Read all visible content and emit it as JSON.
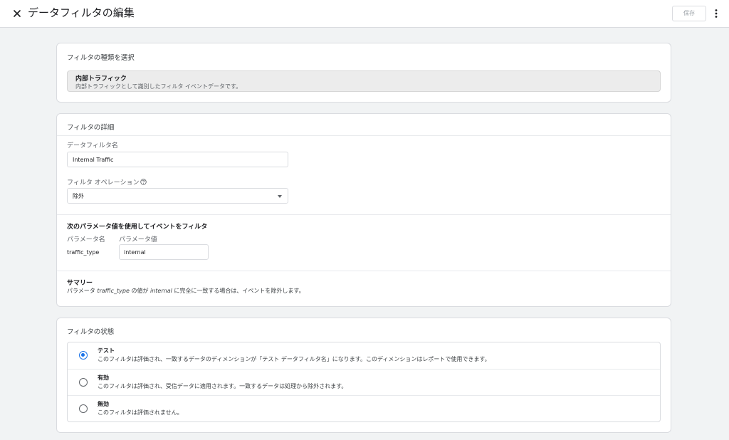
{
  "header": {
    "title": "データフィルタの編集",
    "save_label": "保存"
  },
  "filter_type": {
    "title": "フィルタの種類を選択",
    "name": "内部トラフィック",
    "description": "内部トラフィックとして識別したフィルタ イベントデータです。"
  },
  "details": {
    "title": "フィルタの詳細",
    "name_label": "データフィルタ名",
    "name_value": "Internal Traffic",
    "operation_label": "フィルタ オペレーション",
    "operation_value": "除外",
    "param_heading": "次のパラメータ値を使用してイベントをフィルタ",
    "param_name_col": "パラメータ名",
    "param_value_col": "パラメータ値",
    "param_name": "traffic_type",
    "param_value": "internal",
    "summary_heading": "サマリー",
    "summary_pre": "パラメータ ",
    "summary_param": "traffic_type",
    "summary_mid": " の値が ",
    "summary_value": "internal",
    "summary_post": " に完全に一致する場合は、イベントを除外します。"
  },
  "state": {
    "title": "フィルタの状態",
    "options": [
      {
        "name": "テスト",
        "description": "このフィルタは評価され、一致するデータのディメンションが「テスト データフィルタ名」になります。このディメンションはレポートで使用できます。",
        "selected": true
      },
      {
        "name": "有効",
        "description": "このフィルタは評価され、受信データに適用されます。一致するデータは処理から除外されます。",
        "selected": false
      },
      {
        "name": "無効",
        "description": "このフィルタは評価されません。",
        "selected": false
      }
    ]
  },
  "colors": {
    "accent": "#1a73e8",
    "background": "#f1f3f4",
    "border": "#dadce0"
  },
  "icons": [
    "close-icon",
    "more-vert-icon",
    "help-icon",
    "dropdown-caret-icon"
  ]
}
